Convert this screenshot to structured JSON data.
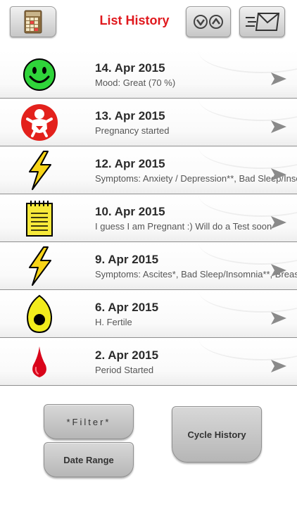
{
  "header": {
    "title": "List History",
    "back_icon": "calendar-grid-icon",
    "sort_icon": "sort-up-down-icon",
    "mail_icon": "send-mail-icon"
  },
  "entries": [
    {
      "date": "14. Apr 2015",
      "detail": "Mood: Great (70 %)",
      "icon": "smiley-face-icon"
    },
    {
      "date": "13. Apr 2015",
      "detail": "Pregnancy started",
      "icon": "baby-icon"
    },
    {
      "date": "12. Apr 2015",
      "detail": "Symptoms: Anxiety / Depression**, Bad Sleep/Insomnia",
      "icon": "lightning-bolt-icon"
    },
    {
      "date": "10. Apr 2015",
      "detail": "I guess I am Pregnant :) Will do a Test soon",
      "icon": "notepad-icon"
    },
    {
      "date": "9. Apr 2015",
      "detail": "Symptoms: Ascites*, Bad Sleep/Insomnia**, Breast",
      "icon": "lightning-bolt-icon"
    },
    {
      "date": "6. Apr 2015",
      "detail": "H. Fertile",
      "icon": "egg-icon"
    },
    {
      "date": "2. Apr 2015",
      "detail": "Period Started",
      "icon": "blood-drop-icon"
    }
  ],
  "buttons": {
    "filter": "*Filter*",
    "date_range": "Date Range",
    "cycle_history": "Cycle History"
  },
  "colors": {
    "title": "#e0191e",
    "mood_green": "#2fd43a",
    "baby_red": "#e3211c",
    "bolt_yellow": "#f7d417",
    "egg_yellow": "#f2ec1c",
    "drop_red": "#d9041a"
  }
}
